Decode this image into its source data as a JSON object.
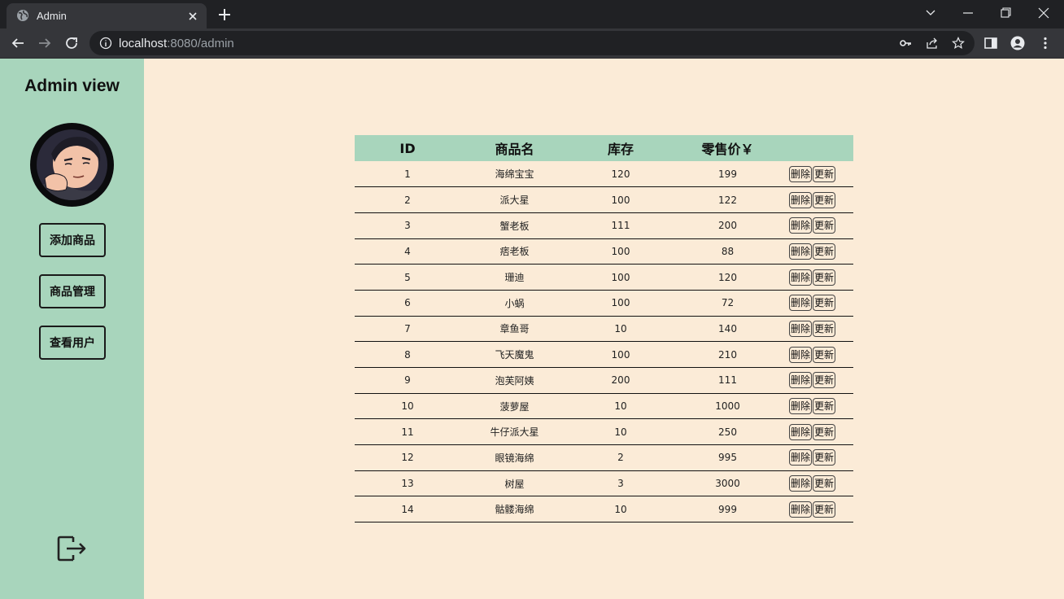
{
  "browser": {
    "tab_title": "Admin",
    "url_host": "localhost",
    "url_path": ":8080/admin"
  },
  "sidebar": {
    "title": "Admin view",
    "buttons": [
      "添加商品",
      "商品管理",
      "查看用户"
    ]
  },
  "table": {
    "headers": [
      "ID",
      "商品名",
      "库存",
      "零售价￥",
      ""
    ],
    "rows": [
      {
        "id": "1",
        "name": "海绵宝宝",
        "stock": "120",
        "price": "199"
      },
      {
        "id": "2",
        "name": "派大星",
        "stock": "100",
        "price": "122"
      },
      {
        "id": "3",
        "name": "蟹老板",
        "stock": "111",
        "price": "200"
      },
      {
        "id": "4",
        "name": "痞老板",
        "stock": "100",
        "price": "88"
      },
      {
        "id": "5",
        "name": "珊迪",
        "stock": "100",
        "price": "120"
      },
      {
        "id": "6",
        "name": "小蜗",
        "stock": "100",
        "price": "72"
      },
      {
        "id": "7",
        "name": "章鱼哥",
        "stock": "10",
        "price": "140"
      },
      {
        "id": "8",
        "name": "飞天魔鬼",
        "stock": "100",
        "price": "210"
      },
      {
        "id": "9",
        "name": "泡芙阿姨",
        "stock": "200",
        "price": "111"
      },
      {
        "id": "10",
        "name": "菠萝屋",
        "stock": "10",
        "price": "1000"
      },
      {
        "id": "11",
        "name": "牛仔派大星",
        "stock": "10",
        "price": "250"
      },
      {
        "id": "12",
        "name": "眼镜海绵",
        "stock": "2",
        "price": "995"
      },
      {
        "id": "13",
        "name": "树屋",
        "stock": "3",
        "price": "3000"
      },
      {
        "id": "14",
        "name": "骷髅海绵",
        "stock": "10",
        "price": "999"
      }
    ],
    "delete_label": "删除",
    "update_label": "更新"
  },
  "colors": {
    "sidebar_bg": "#a8d5bc",
    "page_bg": "#fbebd7",
    "header_bg": "#a8d5bc"
  }
}
